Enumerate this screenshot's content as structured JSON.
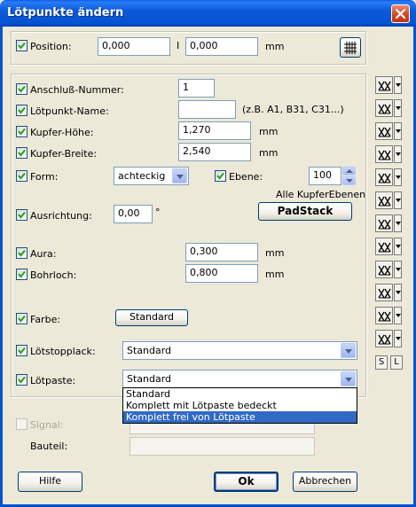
{
  "window": {
    "title": "Lötpunkte ändern"
  },
  "position": {
    "label": "Position:",
    "x_value": "0,000",
    "separator": "I",
    "y_value": "0,000",
    "unit": "mm"
  },
  "fields": {
    "anschluss_label": "Anschluß-Nummer:",
    "anschluss_value": "1",
    "name_label": "Lötpunkt-Name:",
    "name_value": "",
    "name_hint": "(z.B. A1, B31, C31...)",
    "hoehe_label": "Kupfer-Höhe:",
    "hoehe_value": "1,270",
    "hoehe_unit": "mm",
    "breite_label": "Kupfer-Breite:",
    "breite_value": "2,540",
    "breite_unit": "mm",
    "form_label": "Form:",
    "form_value": "achteckig",
    "ebene_label": "Ebene:",
    "ebene_value": "100",
    "ebene_hint": "Alle KupferEbenen",
    "padstack_label": "PadStack",
    "ausrichtung_label": "Ausrichtung:",
    "ausrichtung_value": "0,00",
    "ausrichtung_unit": "°",
    "aura_label": "Aura:",
    "aura_value": "0,300",
    "aura_unit": "mm",
    "bohrloch_label": "Bohrloch:",
    "bohrloch_value": "0,800",
    "bohrloch_unit": "mm",
    "farbe_label": "Farbe:",
    "farbe_button": "Standard",
    "stopplack_label": "Lötstopplack:",
    "stopplack_value": "Standard",
    "paste_label": "Lötpaste:",
    "paste_value": "Standard",
    "paste_options": [
      "Standard",
      "Komplett mit Lötpaste bedeckt",
      "Komplett frei von Lötpaste"
    ],
    "paste_selected_index": 2
  },
  "signal": {
    "label": "Signal:",
    "bauteil_label": "Bauteil:"
  },
  "side": {
    "s_label": "S",
    "l_label": "L"
  },
  "buttons": {
    "hilfe": "Hilfe",
    "ok": "Ok",
    "abbrechen": "Abbrechen"
  },
  "colors": {
    "titlebar": "#0653d2",
    "accent_selection": "#316ac5",
    "dialog_bg": "#ece9d8"
  }
}
